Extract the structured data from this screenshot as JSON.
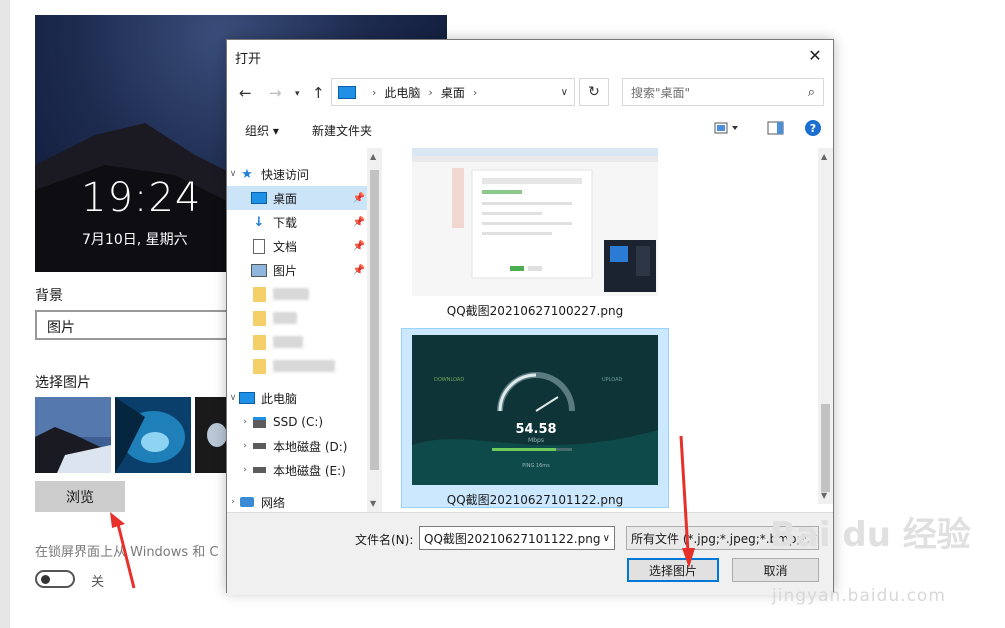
{
  "settings": {
    "lock_time": "19:24",
    "lock_date": "7月10日, 星期六",
    "background_label": "背景",
    "background_value": "图片",
    "choose_picture_label": "选择图片",
    "browse_label": "浏览",
    "lockscreen_desc": "在锁屏界面上从 Windows 和 C",
    "toggle_state_label": "关"
  },
  "dialog": {
    "title": "打开",
    "close_glyph": "✕",
    "breadcrumb": [
      "此电脑",
      "桌面"
    ],
    "search_placeholder": "搜索\"桌面\"",
    "toolbar": {
      "organize": "组织 ▾",
      "new_folder": "新建文件夹"
    },
    "nav": {
      "quick_access": "快速访问",
      "desktop": "桌面",
      "downloads": "下载",
      "documents": "文档",
      "pictures": "图片",
      "this_pc": "此电脑",
      "drive_c": "SSD (C:)",
      "drive_d": "本地磁盘 (D:)",
      "drive_e": "本地磁盘 (E:)",
      "network": "网络"
    },
    "files": [
      {
        "name": "QQ截图20210627100227.png",
        "selected": false
      },
      {
        "name": "QQ截图20210627101122.png",
        "selected": true
      }
    ],
    "filename_label": "文件名(N):",
    "filename_value": "QQ截图20210627101122.png",
    "filetype_value": "所有文件 (*.jpg;*.jpeg;*.bmp;*.",
    "ok_label": "选择图片",
    "cancel_label": "取消"
  },
  "speedtest": {
    "value": "54.58",
    "unit": "Mbps",
    "download_label": "DOWNLOAD",
    "upload_label": "UPLOAD",
    "ping_label": "PING 16ms"
  },
  "watermark": {
    "brand": "Bai du 经验",
    "url": "jingyan.baidu.com"
  },
  "colors": {
    "accent": "#0078d7",
    "selection": "#cce8ff",
    "annotation_red": "#e8302a"
  }
}
